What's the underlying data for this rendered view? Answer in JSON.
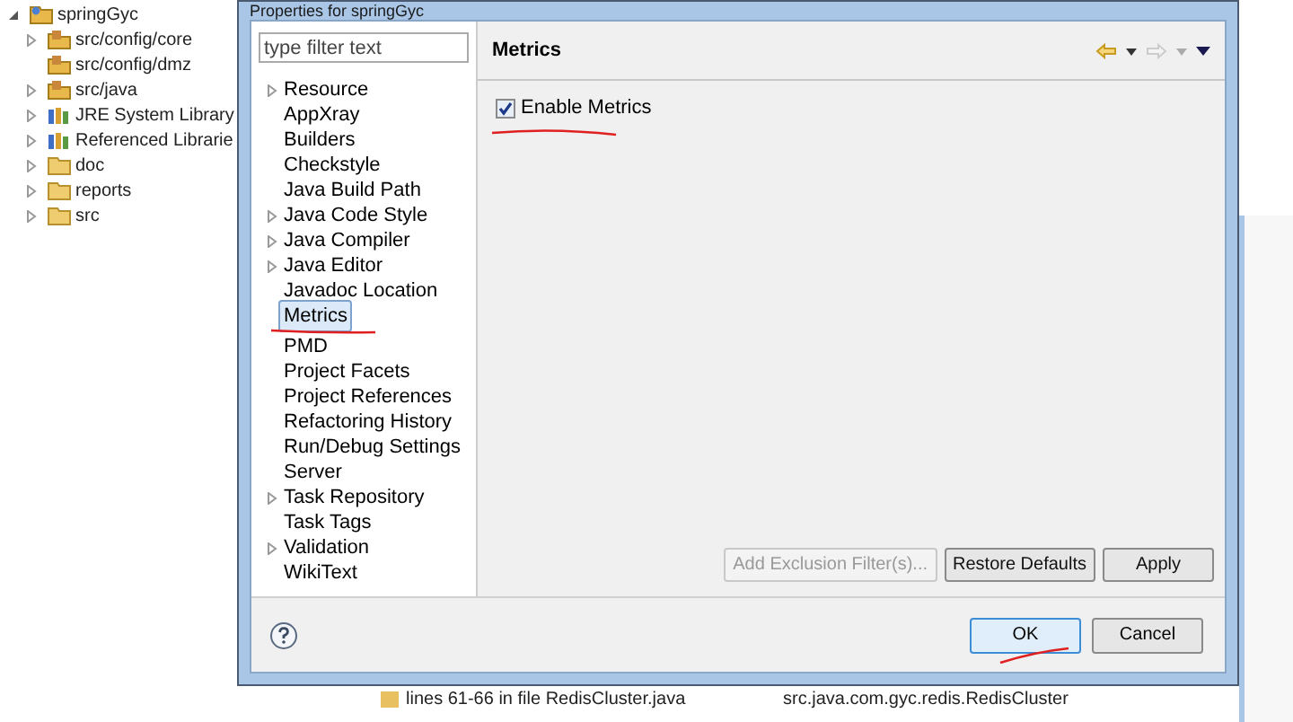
{
  "project_tree": [
    {
      "label": "springGyc",
      "kind": "project",
      "expanded": true,
      "has_children": true,
      "children": [
        {
          "label": "src/config/core",
          "kind": "source-folder",
          "has_children": true,
          "expanded": false
        },
        {
          "label": "src/config/dmz",
          "kind": "source-folder",
          "has_children": false
        },
        {
          "label": "src/java",
          "kind": "source-folder",
          "has_children": true,
          "expanded": false
        },
        {
          "label": "JRE System Library",
          "kind": "library",
          "has_children": true,
          "expanded": false
        },
        {
          "label": "Referenced Librarie",
          "kind": "library",
          "has_children": true,
          "expanded": false
        },
        {
          "label": "doc",
          "kind": "folder",
          "has_children": true,
          "expanded": false
        },
        {
          "label": "reports",
          "kind": "folder",
          "has_children": true,
          "expanded": false
        },
        {
          "label": "src",
          "kind": "folder",
          "has_children": true,
          "expanded": false
        }
      ]
    }
  ],
  "dialog": {
    "title": "Properties for springGyc",
    "filter": {
      "placeholder": "type filter text"
    },
    "nav_items": [
      {
        "label": "Resource",
        "expandable": true,
        "selected": false
      },
      {
        "label": "AppXray",
        "expandable": false,
        "selected": false
      },
      {
        "label": "Builders",
        "expandable": false,
        "selected": false
      },
      {
        "label": "Checkstyle",
        "expandable": false,
        "selected": false
      },
      {
        "label": "Java Build Path",
        "expandable": false,
        "selected": false
      },
      {
        "label": "Java Code Style",
        "expandable": true,
        "selected": false
      },
      {
        "label": "Java Compiler",
        "expandable": true,
        "selected": false
      },
      {
        "label": "Java Editor",
        "expandable": true,
        "selected": false
      },
      {
        "label": "Javadoc Location",
        "expandable": false,
        "selected": false
      },
      {
        "label": "Metrics",
        "expandable": false,
        "selected": true
      },
      {
        "label": "PMD",
        "expandable": false,
        "selected": false
      },
      {
        "label": "Project Facets",
        "expandable": false,
        "selected": false
      },
      {
        "label": "Project References",
        "expandable": false,
        "selected": false
      },
      {
        "label": "Refactoring History",
        "expandable": false,
        "selected": false
      },
      {
        "label": "Run/Debug Settings",
        "expandable": false,
        "selected": false
      },
      {
        "label": "Server",
        "expandable": false,
        "selected": false
      },
      {
        "label": "Task Repository",
        "expandable": true,
        "selected": false
      },
      {
        "label": "Task Tags",
        "expandable": false,
        "selected": false
      },
      {
        "label": "Validation",
        "expandable": true,
        "selected": false
      },
      {
        "label": "WikiText",
        "expandable": false,
        "selected": false
      }
    ],
    "page_title": "Metrics",
    "enable_checkbox": {
      "label": "Enable Metrics",
      "checked": true
    },
    "page_buttons": [
      {
        "label": "Add Exclusion Filter(s)...",
        "disabled": true
      },
      {
        "label": "Restore Defaults",
        "disabled": false
      },
      {
        "label": "Apply",
        "disabled": false
      }
    ],
    "dialog_buttons": [
      {
        "label": "OK",
        "default": true
      },
      {
        "label": "Cancel",
        "default": false
      }
    ]
  },
  "background_row": {
    "description": "lines 61-66 in file RedisCluster.java",
    "resource": "src.java.com.gyc.redis.RedisCluster"
  }
}
